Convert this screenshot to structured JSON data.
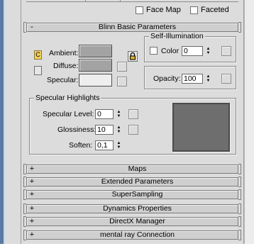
{
  "shader_basic": {
    "checkbox_face_map": "Face Map",
    "checkbox_faceted": "Faceted"
  },
  "rollouts": {
    "blinn_basic": {
      "sign": "-",
      "title": "Blinn Basic Parameters"
    },
    "maps": {
      "sign": "+",
      "title": "Maps"
    },
    "extended": {
      "sign": "+",
      "title": "Extended Parameters"
    },
    "supersampling": {
      "sign": "+",
      "title": "SuperSampling"
    },
    "dynamics": {
      "sign": "+",
      "title": "Dynamics Properties"
    },
    "directx": {
      "sign": "+",
      "title": "DirectX Manager"
    },
    "mental_ray": {
      "sign": "+",
      "title": "mental ray Connection"
    }
  },
  "blinn": {
    "lock_button_letter": "C",
    "ambient_label": "Ambient:",
    "diffuse_label": "Diffuse:",
    "specular_label": "Specular:",
    "ambient_color": "#a3a3a3",
    "diffuse_color": "#a3a3a3",
    "specular_color": "#eeeeee",
    "self_illumination": {
      "title": "Self-Illumination",
      "color_label": "Color",
      "value": "0"
    },
    "opacity": {
      "label": "Opacity:",
      "value": "100"
    }
  },
  "specular_highlights": {
    "title": "Specular Highlights",
    "level_label": "Specular Level:",
    "level_value": "0",
    "glossiness_label": "Glossiness:",
    "glossiness_value": "10",
    "soften_label": "Soften:",
    "soften_value": "0,1",
    "curve_preview_color": "#6e6e6e"
  }
}
